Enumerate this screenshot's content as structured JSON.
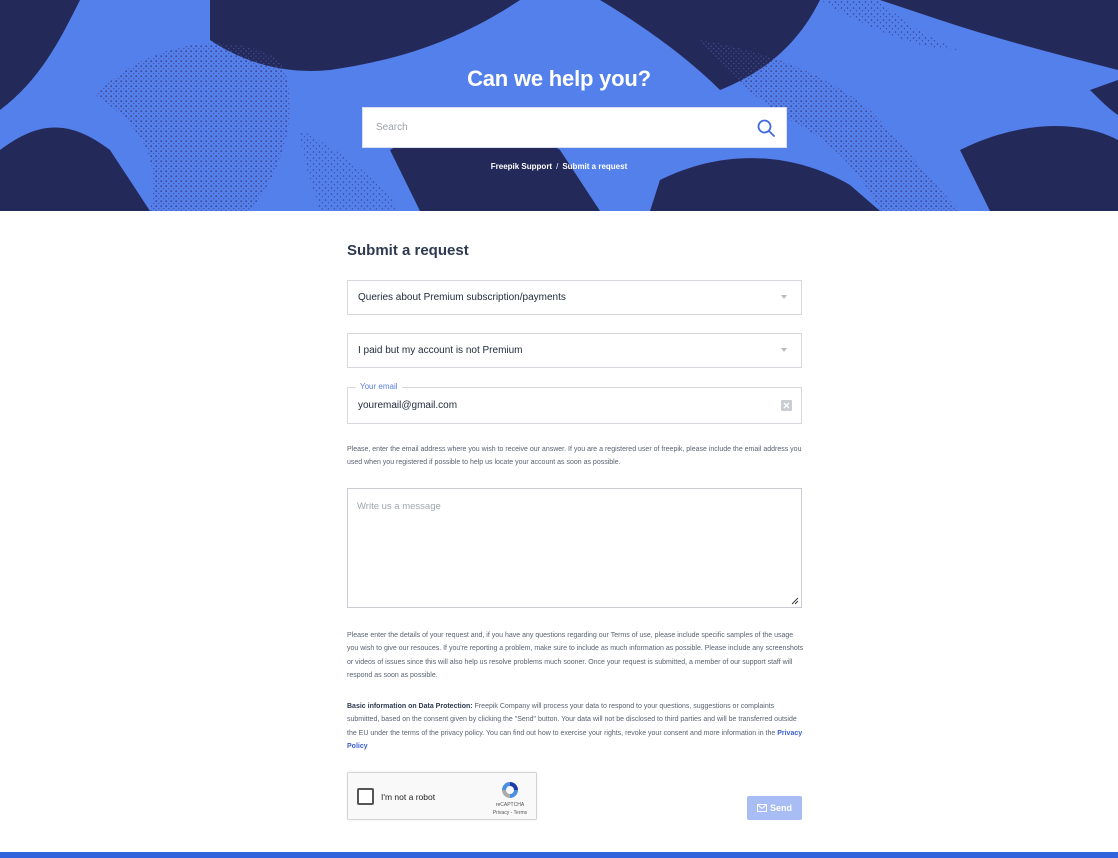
{
  "hero": {
    "title": "Can we help you?",
    "search_placeholder": "Search",
    "breadcrumb": {
      "items": [
        "Freepik Support",
        "Submit a request"
      ],
      "separator": "/"
    },
    "colors": {
      "background": "#5480ec",
      "dark_shape": "#232a5a"
    }
  },
  "form": {
    "title": "Submit a request",
    "topic_select": {
      "value": "Queries about Premium subscription/payments"
    },
    "subtopic_select": {
      "value": "I paid but my account is not Premium"
    },
    "email": {
      "legend": "Your email",
      "value": "youremail@gmail.com"
    },
    "email_help": "Please, enter the email address where you wish to receive our answer. If you are a registered user of freepik, please include the email address you used when you registered if possible to help us locate your account as soon as possible.",
    "message_placeholder": "Write us a message",
    "message_help": "Please enter the details of your request and, if you have any questions regarding our Terms of use, please include specific samples of the usage you wish to give our resouces. If you're reporting a problem, make sure to include as much information as possible. Please include any screenshots or videos of issues since this will also help us resolve problems much sooner. Once your request is submitted, a member of our support staff will respond as soon as possible.",
    "data_protection": {
      "heading": "Basic information on Data Protection:",
      "text": "Freepik Company will process your data to respond to your questions, suggestions or complaints submitted, based on the consent given by clicking the \"Send\" button. Your data will not be disclosed to third parties and will be transferred outside the EU under the terms of the privacy policy. You can find out how to exercise your rights, revoke your consent and more information in the",
      "link": "Privacy Policy"
    },
    "captcha": {
      "label": "I'm not a robot",
      "brand": "reCAPTCHA",
      "links": "Privacy - Terms"
    },
    "send_label": "Send",
    "colors": {
      "send_button": "#a7bdf4",
      "link": "#3a5fd4",
      "footer_bar": "#3263dc"
    }
  }
}
